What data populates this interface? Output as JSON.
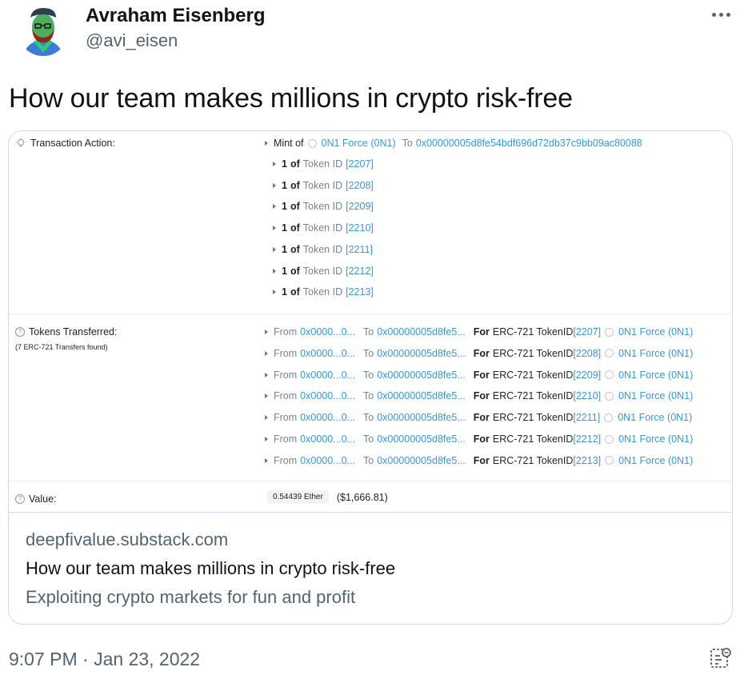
{
  "author": {
    "name": "Avraham Eisenberg",
    "handle": "@avi_eisen"
  },
  "tweet": {
    "text": "How our team makes millions in crypto risk-free",
    "timestamp": "9:07 PM · Jan 23, 2022"
  },
  "icons": {
    "more": "more-horizontal-icon",
    "analytics": "tweet-analytics-icon",
    "bulb": "lightbulb-icon",
    "help": "question-circle-icon",
    "token": "token-circle-icon"
  },
  "colors": {
    "link": "#3498db",
    "muted": "#536471",
    "border": "#cfd9de"
  },
  "card": {
    "domain": "deepfivalue.substack.com",
    "title": "How our team makes millions in crypto risk-free",
    "description": "Exploiting crypto markets for fun and profit",
    "transaction": {
      "action_label": "Transaction Action:",
      "mint": {
        "prefix": "Mint of",
        "token": "0N1 Force (0N1)",
        "to_label": "To",
        "to_address": "0x00000005d8fe54bdf696d72db37c9bb09ac80088"
      },
      "token_items": [
        {
          "qty": "1",
          "of": "of",
          "label": "Token ID",
          "id": "[2207]"
        },
        {
          "qty": "1",
          "of": "of",
          "label": "Token ID",
          "id": "[2208]"
        },
        {
          "qty": "1",
          "of": "of",
          "label": "Token ID",
          "id": "[2209]"
        },
        {
          "qty": "1",
          "of": "of",
          "label": "Token ID",
          "id": "[2210]"
        },
        {
          "qty": "1",
          "of": "of",
          "label": "Token ID",
          "id": "[2211]"
        },
        {
          "qty": "1",
          "of": "of",
          "label": "Token ID",
          "id": "[2212]"
        },
        {
          "qty": "1",
          "of": "of",
          "label": "Token ID",
          "id": "[2213]"
        }
      ],
      "transfers_label": "Tokens Transferred:",
      "transfers_sub": "(7 ERC-721 Transfers found)",
      "transfers": [
        {
          "from_label": "From",
          "from": "0x0000...0...",
          "to_label": "To",
          "to": "0x00000005d8fe5...",
          "for_label": "For",
          "standard": "ERC-721 TokenID",
          "id": "[2207]",
          "token": "0N1 Force (0N1)"
        },
        {
          "from_label": "From",
          "from": "0x0000...0...",
          "to_label": "To",
          "to": "0x00000005d8fe5...",
          "for_label": "For",
          "standard": "ERC-721 TokenID",
          "id": "[2208]",
          "token": "0N1 Force (0N1)"
        },
        {
          "from_label": "From",
          "from": "0x0000...0...",
          "to_label": "To",
          "to": "0x00000005d8fe5...",
          "for_label": "For",
          "standard": "ERC-721 TokenID",
          "id": "[2209]",
          "token": "0N1 Force (0N1)"
        },
        {
          "from_label": "From",
          "from": "0x0000...0...",
          "to_label": "To",
          "to": "0x00000005d8fe5...",
          "for_label": "For",
          "standard": "ERC-721 TokenID",
          "id": "[2210]",
          "token": "0N1 Force (0N1)"
        },
        {
          "from_label": "From",
          "from": "0x0000...0...",
          "to_label": "To",
          "to": "0x00000005d8fe5...",
          "for_label": "For",
          "standard": "ERC-721 TokenID",
          "id": "[2211]",
          "token": "0N1 Force (0N1)"
        },
        {
          "from_label": "From",
          "from": "0x0000...0...",
          "to_label": "To",
          "to": "0x00000005d8fe5...",
          "for_label": "For",
          "standard": "ERC-721 TokenID",
          "id": "[2212]",
          "token": "0N1 Force (0N1)"
        },
        {
          "from_label": "From",
          "from": "0x0000...0...",
          "to_label": "To",
          "to": "0x00000005d8fe5...",
          "for_label": "For",
          "standard": "ERC-721 TokenID",
          "id": "[2213]",
          "token": "0N1 Force (0N1)"
        }
      ],
      "value_label": "Value:",
      "value_ether": "0.54439 Ether",
      "value_usd": "($1,666.81)"
    }
  }
}
